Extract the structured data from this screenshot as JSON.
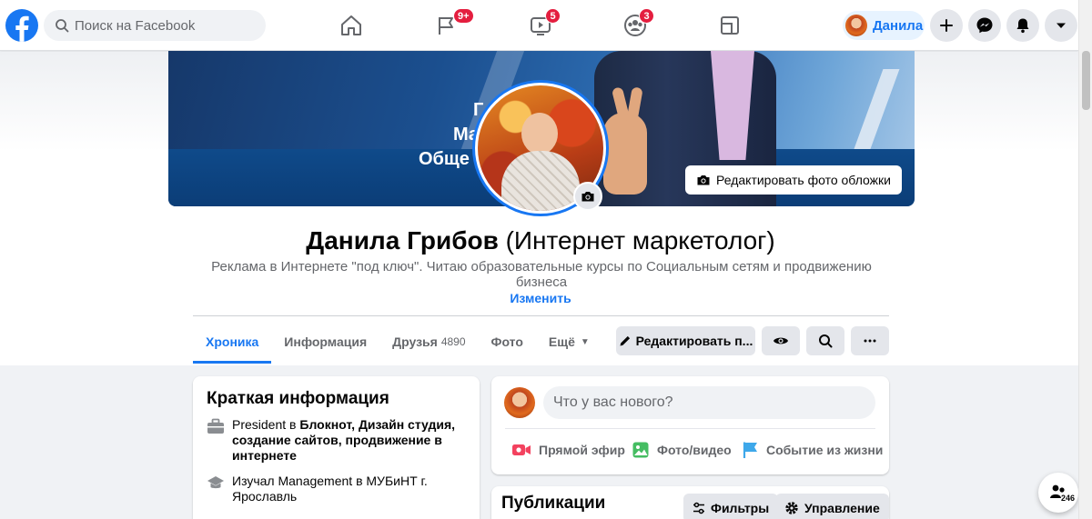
{
  "nav": {
    "search_placeholder": "Поиск на Facebook",
    "badges": {
      "pages": "9+",
      "watch": "5",
      "groups": "3"
    },
    "profile_name": "Данила"
  },
  "cover": {
    "text_lines": [
      "Г  р",
      "Ма",
      "Обще"
    ],
    "edit_button": "Редактировать фото обложки"
  },
  "profile": {
    "name": "Данила Грибов",
    "alt_name": "(Интернет маркетолог)",
    "bio": "Реклама в Интернете \"под ключ\". Читаю образовательные курсы по Социальным сетям и продвижению бизнеса",
    "edit_link": "Изменить"
  },
  "tabs": [
    {
      "label": "Хроника"
    },
    {
      "label": "Информация"
    },
    {
      "label": "Друзья",
      "count": "4890"
    },
    {
      "label": "Фото"
    },
    {
      "label": "Ещё"
    }
  ],
  "actions": {
    "edit_profile": "Редактировать п..."
  },
  "intro": {
    "title": "Краткая информация",
    "work_prefix": "President в ",
    "work_place": "Блокнот, Дизайн студия, создание сайтов, продвижение в интернете",
    "education": "Изучал Management в МУБиНТ г. Ярославль"
  },
  "composer": {
    "placeholder": "Что у вас нового?",
    "live": "Прямой эфир",
    "photo": "Фото/видео",
    "life_event": "Событие из жизни"
  },
  "posts": {
    "title": "Публикации",
    "filters": "Фильтры",
    "manage": "Управление"
  },
  "floating": {
    "count": "246"
  },
  "colors": {
    "brand": "#1877f2",
    "badge": "#e41e3f",
    "live": "#f3425f",
    "photo": "#45bd62",
    "event": "#3ea8ea"
  }
}
